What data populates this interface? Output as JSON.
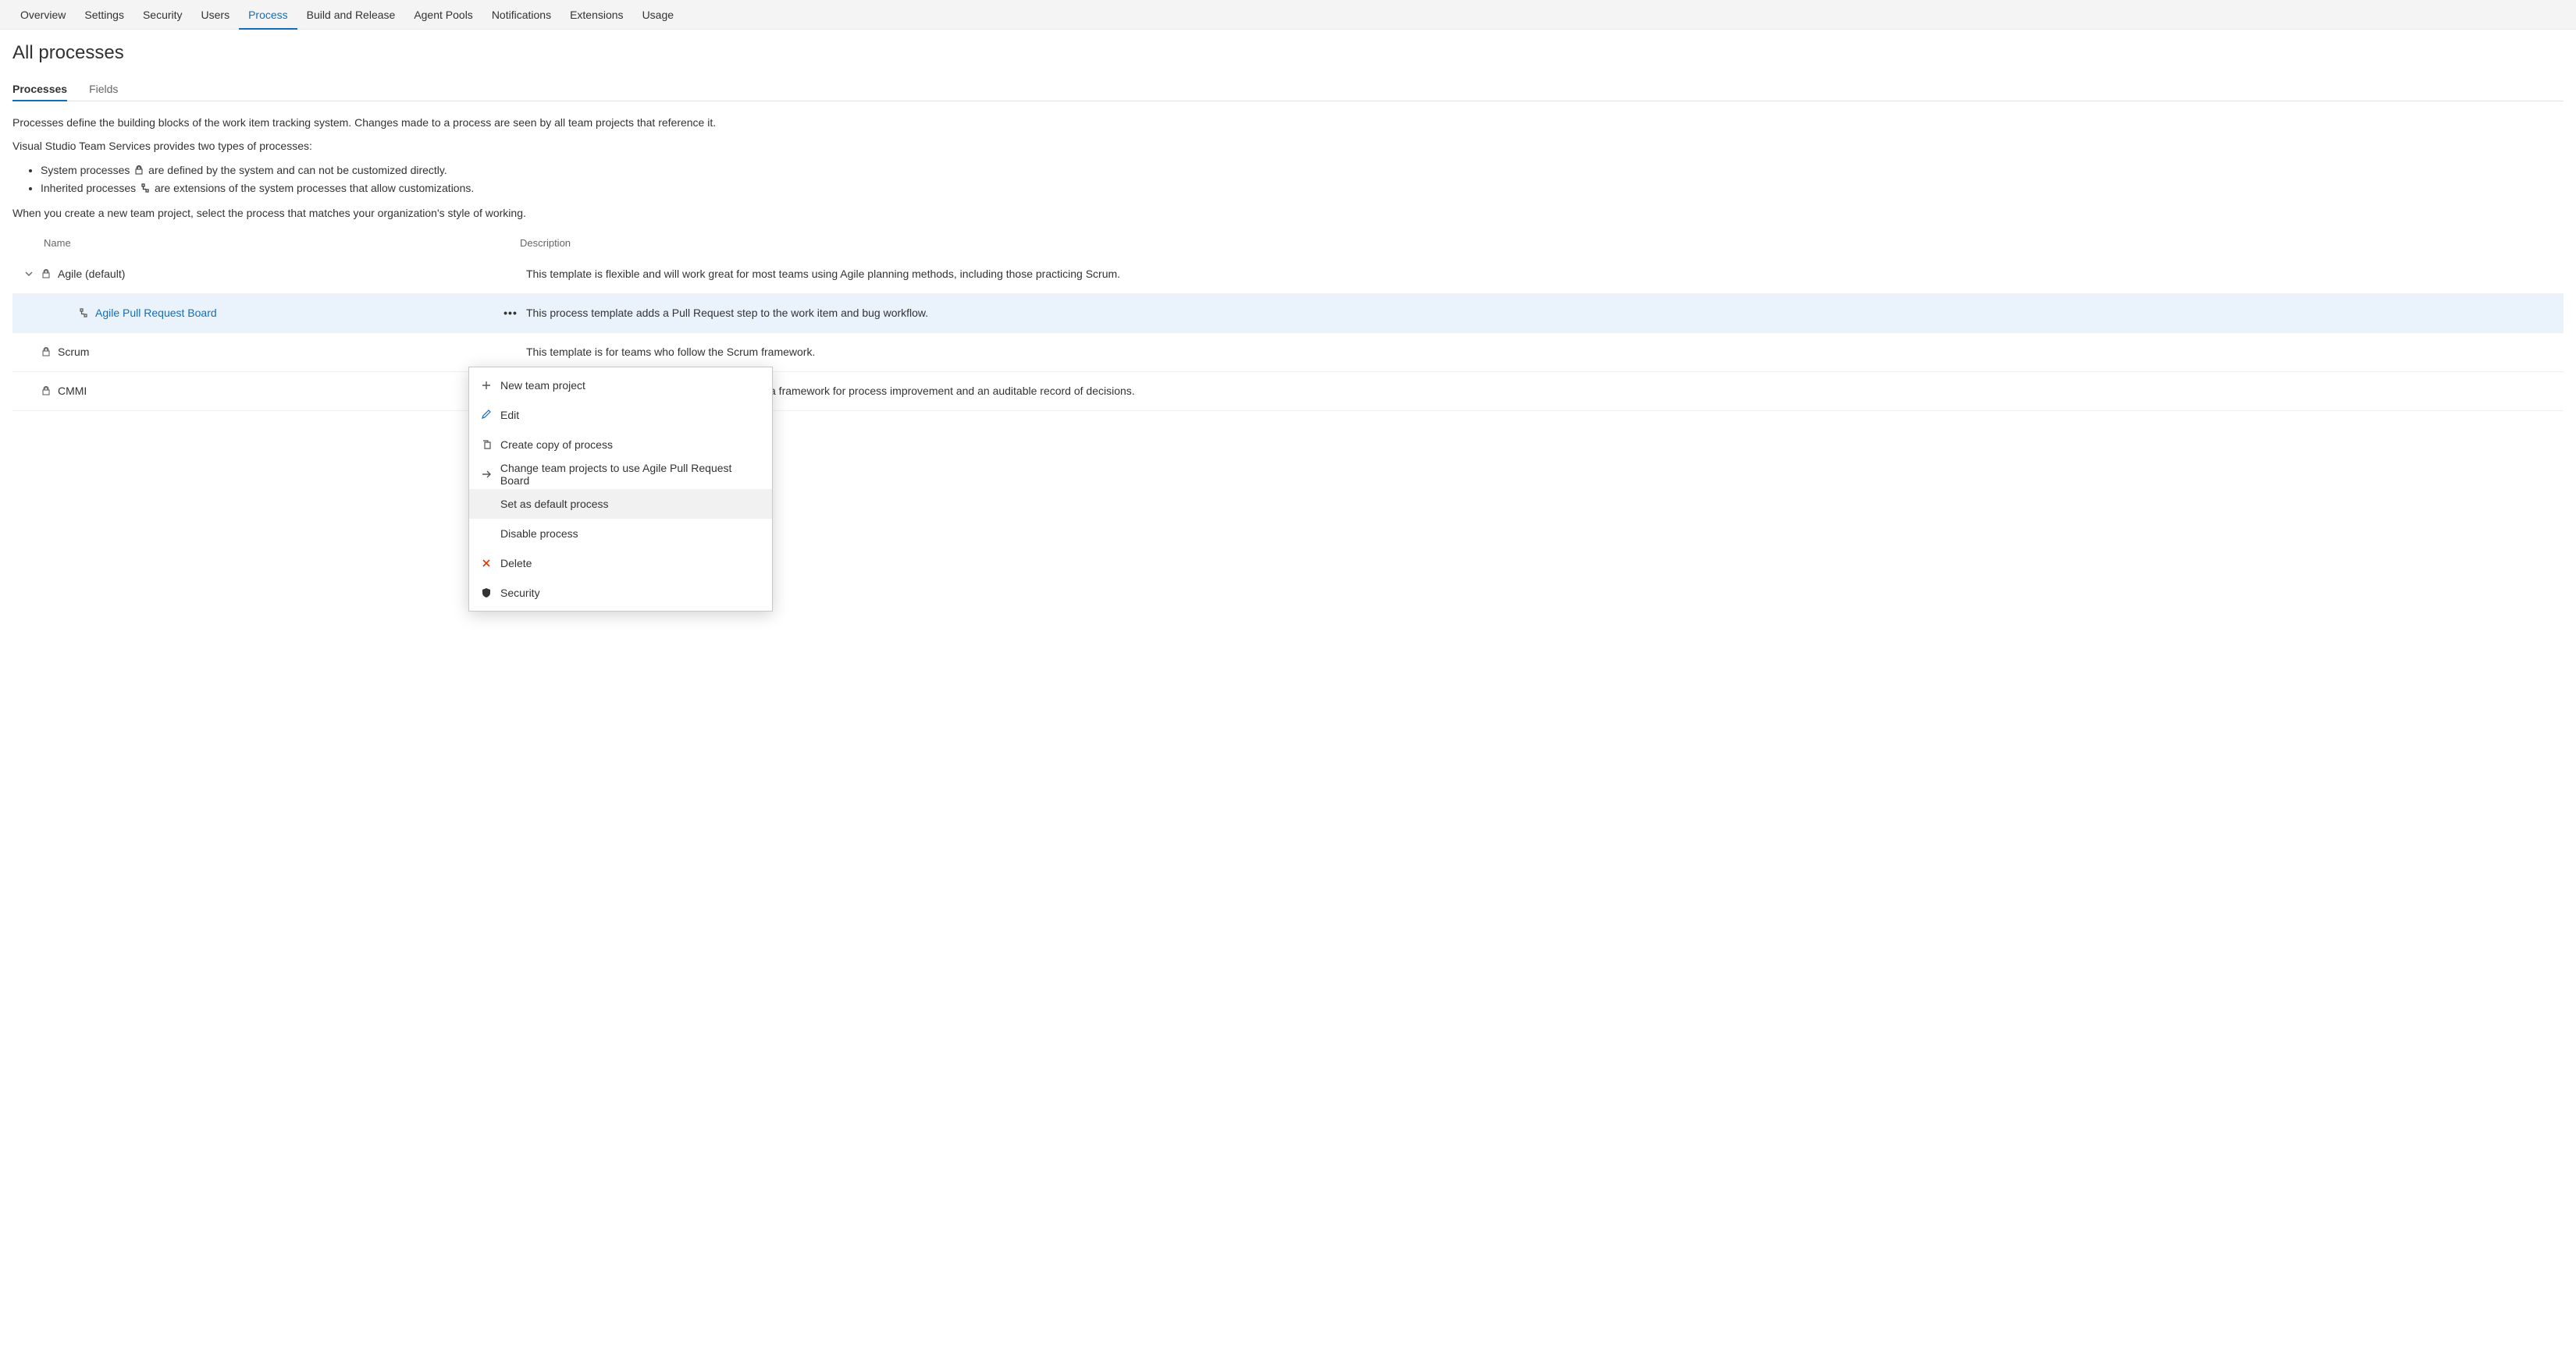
{
  "topnav": {
    "items": [
      "Overview",
      "Settings",
      "Security",
      "Users",
      "Process",
      "Build and Release",
      "Agent Pools",
      "Notifications",
      "Extensions",
      "Usage"
    ],
    "active_index": 4
  },
  "page_title": "All processes",
  "subtabs": {
    "items": [
      "Processes",
      "Fields"
    ],
    "active_index": 0
  },
  "intro": {
    "para1": "Processes define the building blocks of the work item tracking system. Changes made to a process are seen by all team projects that reference it.",
    "para2": "Visual Studio Team Services provides two types of processes:",
    "bullet1a": "System processes ",
    "bullet1b": " are defined by the system and can not be customized directly.",
    "bullet2a": "Inherited processes ",
    "bullet2b": " are extensions of the system processes that allow customizations.",
    "para3": "When you create a new team project, select the process that matches your organization's style of working."
  },
  "table": {
    "col_name": "Name",
    "col_desc": "Description",
    "rows": [
      {
        "name": "Agile (default)",
        "desc": "This template is flexible and will work great for most teams using Agile planning methods, including those practicing Scrum."
      },
      {
        "name": "Agile Pull Request Board",
        "desc": "This process template adds a Pull Request step to the work item and bug workflow."
      },
      {
        "name": "Scrum",
        "desc": "This template is for teams who follow the Scrum framework."
      },
      {
        "name": "CMMI",
        "desc": "This template is for more formal projects requiring a framework for process improvement and an auditable record of decisions."
      }
    ],
    "actions_glyph": "•••"
  },
  "context_menu": {
    "items": [
      {
        "label": "New team project"
      },
      {
        "label": "Edit"
      },
      {
        "label": "Create copy of process"
      },
      {
        "label": "Change team projects to use Agile Pull Request Board"
      },
      {
        "label": "Set as default process"
      },
      {
        "label": "Disable process"
      },
      {
        "label": "Delete"
      },
      {
        "label": "Security"
      }
    ],
    "hover_index": 4
  }
}
